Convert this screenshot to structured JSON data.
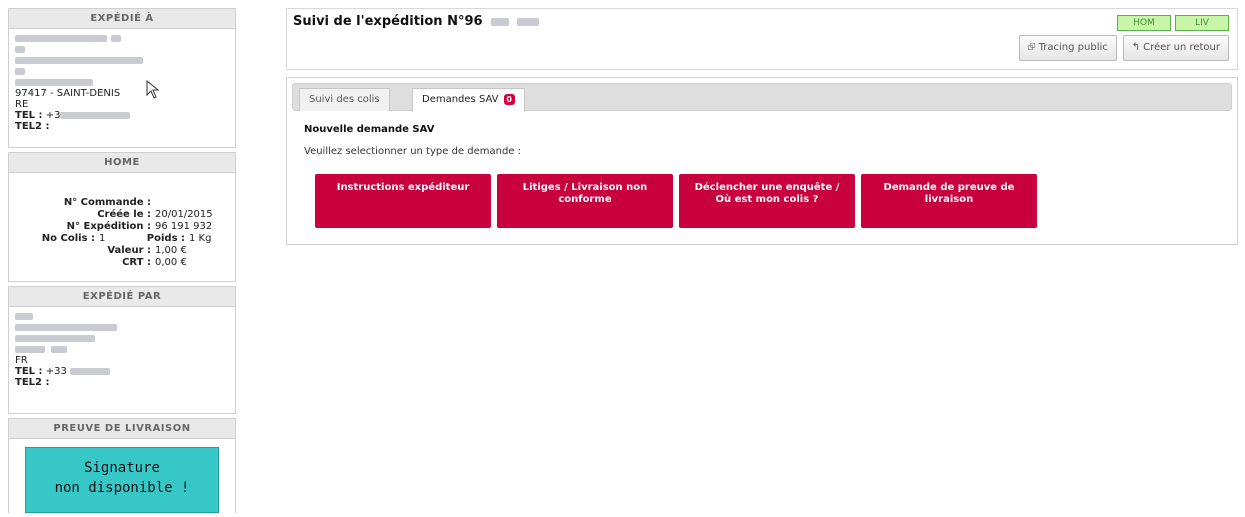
{
  "expedie_a": {
    "header": "EXPÉDIÉ À",
    "city_line": "97417 - SAINT-DENIS",
    "country": "RE",
    "tel_label": "TEL :",
    "tel_value": "+3",
    "tel2_label": "TEL2 :"
  },
  "home": {
    "header": "HOME",
    "rows": [
      {
        "label": "N° Commande :",
        "value": ""
      },
      {
        "label": "Créée le :",
        "value": "20/01/2015"
      },
      {
        "label": "N° Expédition :",
        "value": "96 191 932"
      }
    ],
    "colis_label": "No Colis :",
    "colis_value": "1",
    "poids_label": "Poids :",
    "poids_value": "1 Kg",
    "valeur_label": "Valeur :",
    "valeur_value": "1,00 €",
    "crt_label": "CRT :",
    "crt_value": "0,00 €"
  },
  "expedie_par": {
    "header": "EXPÉDIÉ PAR",
    "country": "FR",
    "tel_label": "TEL :",
    "tel_value": "+33",
    "tel2_label": "TEL2 :"
  },
  "preuve": {
    "header": "PREUVE DE LIVRAISON",
    "line1": "Signature",
    "line2": "non disponible !"
  },
  "main": {
    "title": "Suivi de l'expédition N°96",
    "badges": [
      "HOM",
      "LIV"
    ],
    "tracing_label": "Tracing public",
    "retour_label": "Créer un retour",
    "tabs": [
      {
        "label": "Suivi des colis"
      },
      {
        "label": "Demandes SAV",
        "count": "0"
      }
    ],
    "section_title": "Nouvelle demande SAV",
    "section_sub": "Veuillez selectionner un type de demande :",
    "sav_buttons": [
      "Instructions expéditeur",
      "Litiges / Livraison non conforme",
      "Déclencher une enquête / Où est mon colis ?",
      "Demande de preuve de livraison"
    ]
  },
  "colors": {
    "accent": "#c8003e",
    "signature_bg": "#37c7c6",
    "badge_green": "#c9f5a9"
  }
}
